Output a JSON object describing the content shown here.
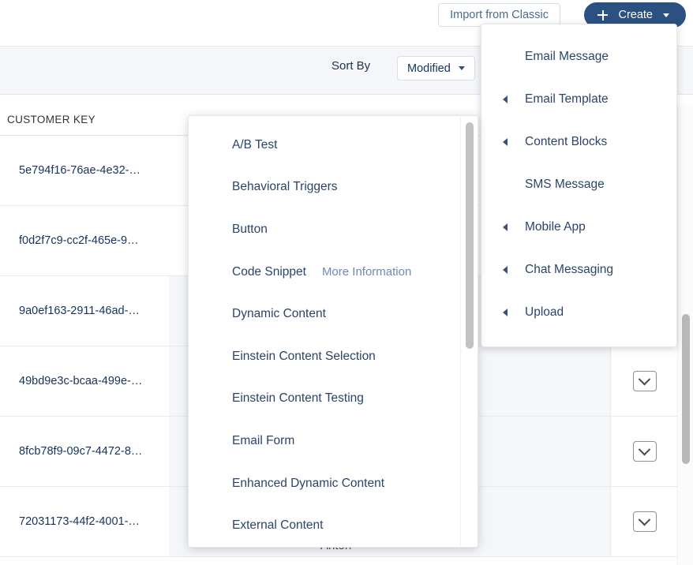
{
  "toolbar": {
    "import_label": "Import from Classic",
    "create_label": "Create",
    "plus_icon": "plus-icon",
    "caret_icon": "caret-down-icon"
  },
  "sortbar": {
    "sort_by_label": "Sort By",
    "sort_value": "Modified",
    "caret_icon": "caret-down-icon"
  },
  "table": {
    "columns": [
      "CUSTOMER KEY",
      "",
      ""
    ],
    "rows": [
      {
        "customer_key": "5e794f16-76ae-4e32-…",
        "action_icon": "chevron-down-icon"
      },
      {
        "customer_key": "f0d2f7c9-cc2f-465e-9…",
        "action_icon": "chevron-down-icon"
      },
      {
        "customer_key": "9a0ef163-2911-46ad-…",
        "action_icon": "chevron-down-icon"
      },
      {
        "customer_key": "49bd9e3c-bcaa-499e-…",
        "action_icon": "chevron-down-icon"
      },
      {
        "customer_key": "8fcb78f9-09c7-4472-8…",
        "action_icon": "chevron-down-icon"
      },
      {
        "customer_key": "72031173-44f2-4001-…",
        "action_icon": "chevron-down-icon"
      }
    ],
    "partial_name": "Anton"
  },
  "create_menu": {
    "items": [
      {
        "label": "Email Message",
        "submenu": false
      },
      {
        "label": "Email Template",
        "submenu": true
      },
      {
        "label": "Content Blocks",
        "submenu": true
      },
      {
        "label": "SMS Message",
        "submenu": false
      },
      {
        "label": "Mobile App",
        "submenu": true
      },
      {
        "label": "Chat Messaging",
        "submenu": true
      },
      {
        "label": "Upload",
        "submenu": true
      }
    ],
    "submenu_icon": "triangle-left-icon"
  },
  "type_menu": {
    "items": [
      {
        "label": "A/B Test",
        "more": ""
      },
      {
        "label": "Behavioral Triggers",
        "more": ""
      },
      {
        "label": "Button",
        "more": ""
      },
      {
        "label": "Code Snippet",
        "more": "More Information"
      },
      {
        "label": "Dynamic Content",
        "more": ""
      },
      {
        "label": "Einstein Content Selection",
        "more": ""
      },
      {
        "label": "Einstein Content Testing",
        "more": ""
      },
      {
        "label": "Email Form",
        "more": ""
      },
      {
        "label": "Enhanced Dynamic Content",
        "more": ""
      },
      {
        "label": "External Content",
        "more": ""
      }
    ]
  },
  "colors": {
    "brand_navy": "#2b5182",
    "text_navy": "#16325c",
    "link_blue": "#6b8ab5",
    "panel_gray": "#f4f6f9",
    "border": "#dfe3ea"
  }
}
